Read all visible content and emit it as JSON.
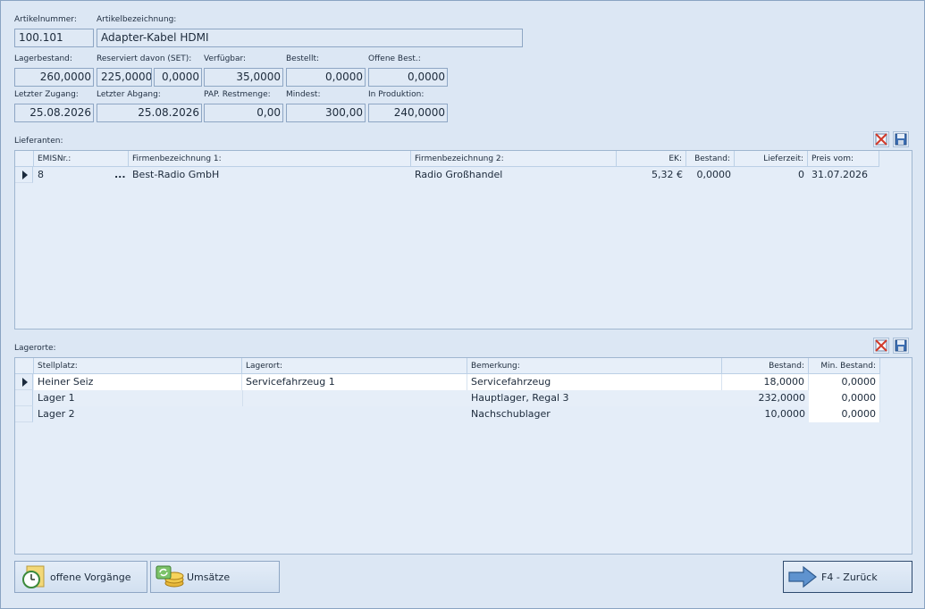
{
  "article": {
    "number_label": "Artikelnummer:",
    "number": "100.101",
    "name_label": "Artikelbezeichnung:",
    "name": "Adapter-Kabel HDMI"
  },
  "stock": {
    "lagerbestand_label": "Lagerbestand:",
    "lagerbestand": "260,0000",
    "reserviert_label": "Reserviert davon (SET):",
    "reserviert": "225,0000",
    "reserviert_set": "0,0000",
    "verfuegbar_label": "Verfügbar:",
    "verfuegbar": "35,0000",
    "bestellt_label": "Bestellt:",
    "bestellt": "0,0000",
    "offene_label": "Offene Best.:",
    "offene": "0,0000",
    "zugang_label": "Letzter Zugang:",
    "zugang": "25.08.2026",
    "abgang_label": "Letzter Abgang:",
    "abgang": "25.08.2026",
    "restmenge_label": "PAP. Restmenge:",
    "restmenge": "0,00",
    "mindest_label": "Mindest:",
    "mindest": "300,00",
    "produktion_label": "In Produktion:",
    "produktion": "240,0000"
  },
  "suppliers": {
    "title": "Lieferanten:",
    "columns": [
      "EMISNr.:",
      "Firmenbezeichnung 1:",
      "Firmenbezeichnung 2:",
      "EK:",
      "Bestand:",
      "Lieferzeit:",
      "Preis vom:"
    ],
    "rows": [
      {
        "emis": "8",
        "ellipsis": "...",
        "firma1": "Best-Radio GmbH",
        "firma2": "Radio Großhandel",
        "ek": "5,32 €",
        "bestand": "0,0000",
        "lieferzeit": "0",
        "preis_vom": "31.07.2026"
      }
    ]
  },
  "locations": {
    "title": "Lagerorte:",
    "columns": [
      "Stellplatz:",
      "Lagerort:",
      "Bemerkung:",
      "Bestand:",
      "Min. Bestand:"
    ],
    "rows": [
      {
        "stellplatz": "Heiner Seiz",
        "lagerort": "Servicefahrzeug 1",
        "bemerkung": "Servicefahrzeug",
        "bestand": "18,0000",
        "min": "0,0000"
      },
      {
        "stellplatz": "Lager 1",
        "lagerort": "",
        "bemerkung": "Hauptlager, Regal 3",
        "bestand": "232,0000",
        "min": "0,0000"
      },
      {
        "stellplatz": "Lager 2",
        "lagerort": "",
        "bemerkung": "Nachschublager",
        "bestand": "10,0000",
        "min": "0,0000"
      }
    ]
  },
  "buttons": {
    "open_processes": "offene Vorgänge",
    "sales": "Umsätze",
    "back": "F4 - Zurück"
  },
  "icons": {
    "delete": "delete-icon",
    "save": "save-icon",
    "clock": "clock-icon",
    "coins": "coins-icon",
    "arrow_right": "arrow-right-icon"
  }
}
